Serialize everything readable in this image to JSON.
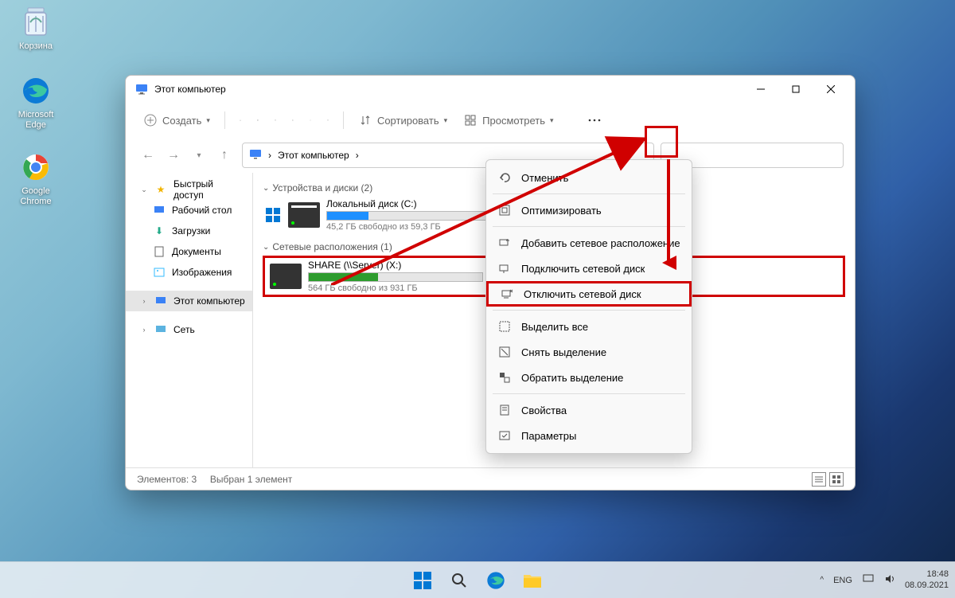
{
  "desktop": {
    "recycle": "Корзина",
    "edge": "Microsoft Edge",
    "chrome": "Google Chrome"
  },
  "window": {
    "title": "Этот компьютер",
    "toolbar": {
      "create": "Создать",
      "sort": "Сортировать",
      "view": "Просмотреть"
    },
    "address": {
      "path": "Этот компьютер",
      "sep": "›"
    },
    "sidebar": {
      "quick": "Быстрый доступ",
      "desktop": "Рабочий стол",
      "downloads": "Загрузки",
      "documents": "Документы",
      "images": "Изображения",
      "thispc": "Этот компьютер",
      "network": "Сеть"
    },
    "groups": {
      "devices": "Устройства и диски (2)",
      "network": "Сетевые расположения (1)"
    },
    "drives": {
      "c": {
        "name": "Локальный диск (C:)",
        "sub": "45,2 ГБ свободно из 59,3 ГБ",
        "fill_pct": 24,
        "color": "#1e90ff"
      },
      "x": {
        "name": "SHARE (\\\\Server) (X:)",
        "sub": "564 ГБ свободно из 931 ГБ",
        "fill_pct": 40,
        "color": "#2e9c2e"
      }
    },
    "status": {
      "count": "Элементов: 3",
      "sel": "Выбран 1 элемент"
    }
  },
  "context_menu": {
    "undo": "Отменить",
    "optimize": "Оптимизировать",
    "add_net": "Добавить сетевое расположение",
    "connect": "Подключить сетевой диск",
    "disconnect": "Отключить сетевой диск",
    "select_all": "Выделить все",
    "deselect": "Снять выделение",
    "invert": "Обратить выделение",
    "properties": "Свойства",
    "options": "Параметры"
  },
  "taskbar": {
    "tray": {
      "lang": "ENG",
      "time": "18:48",
      "date": "08.09.2021"
    }
  }
}
